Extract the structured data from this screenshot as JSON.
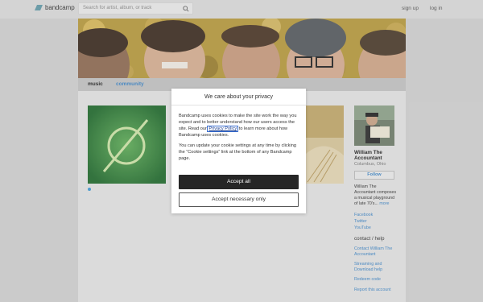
{
  "header": {
    "logo_text": "bandcamp",
    "search_placeholder": "Search for artist, album, or track",
    "signup_label": "sign up",
    "login_label": "log in",
    "brand_color": "#629aa9"
  },
  "tabs": [
    {
      "label": "music",
      "active": true
    },
    {
      "label": "community",
      "active": false
    }
  ],
  "artist": {
    "name": "William The Accountant",
    "location": "Columbus, Ohio",
    "follow_label": "Follow",
    "bio": "William The Accountant composes a musical playground of late 70's...",
    "more_label": "more",
    "links": [
      "Facebook",
      "Twitter",
      "YouTube"
    ],
    "contact_heading": "contact / help",
    "contact_link": "Contact William The Accountant",
    "streaming_link": "Streaming and Download help",
    "redeem_link": "Redeem code",
    "report_link": "Report this account"
  },
  "cookie_dialog": {
    "title": "We care about your privacy",
    "p1_a": "Bandcamp uses cookies to make the site work the way you expect and to better understand how our users access the site. Read our ",
    "privacy_link": "Privacy Policy",
    "p1_b": " to learn more about how Bandcamp uses cookies.",
    "p2": "You can update your cookie settings at any time by clicking the “Cookie settings” link at the bottom of any Bandcamp page.",
    "accept_all_label": "Accept all",
    "accept_necessary_label": "Accept necessary only"
  },
  "colors": {
    "link": "#3e86c7",
    "accept_bg": "#262626"
  }
}
